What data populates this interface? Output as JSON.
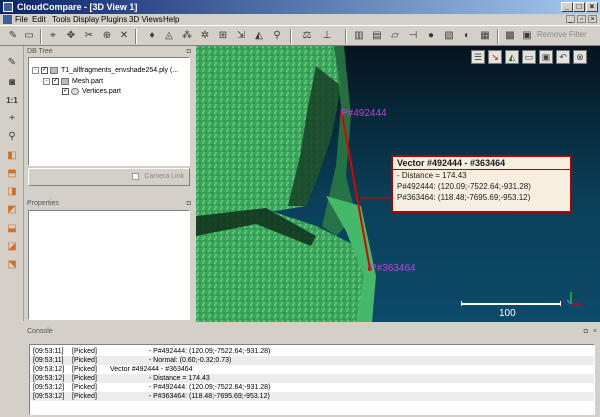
{
  "window": {
    "title": "CloudCompare - [3D View 1]",
    "minimize_label": "_",
    "maximize_label": "□",
    "close_label": "×"
  },
  "menu": {
    "items": [
      "File",
      "Edit",
      "Tools",
      "Display",
      "Plugins",
      "3D Views",
      "Help"
    ],
    "mdi_buttons": [
      "_",
      "▫",
      "×"
    ]
  },
  "toolbar": {
    "remove_filter_label": "Remove Filter",
    "icons": [
      "open-icon",
      "save-icon",
      "select-icon",
      "translate-icon",
      "segment-icon",
      "merge-icon",
      "delete-icon",
      "pick-point-icon",
      "mesh-icon",
      "sample-icon",
      "normals-icon",
      "octree-icon",
      "distance-icon",
      "filter-icon",
      "pivot-icon",
      "histogram-icon",
      "statistics-icon",
      "plane-icon",
      "sphere-icon",
      "scalar-field-icon",
      "color-icon",
      "sf-gradient-icon"
    ]
  },
  "left_toolbar": {
    "icons": [
      "ruler-icon",
      "camera-icon",
      "one-to-one-icon",
      "crosshair-icon",
      "zoom-icon",
      "front-view-icon",
      "top-view-icon",
      "left-view-icon",
      "back-view-icon",
      "bottom-view-icon",
      "right-view-icon",
      "iso-view-icon"
    ]
  },
  "db_tree": {
    "title": "DB Tree",
    "float_button": "◘",
    "items": [
      {
        "label": "T1_allfragments_envshade254.ply (...",
        "level": 0,
        "expand": "-",
        "checked": "✓"
      },
      {
        "label": "Mesh.part",
        "level": 1,
        "expand": "-",
        "checked": "✓"
      },
      {
        "label": "Vertices.part",
        "level": 2,
        "expand": "",
        "checked": "✓"
      }
    ],
    "camera_link_label": "Camera Link"
  },
  "properties": {
    "title": "Properties",
    "float_button": "◘"
  },
  "view3d": {
    "tool_icons": [
      "layers-icon",
      "pick-vector-icon",
      "pick-triangle-icon",
      "pick-rect-icon",
      "save-pick-icon",
      "undo-icon",
      "close-icon"
    ],
    "tooltip": {
      "title": "Vector #492444 - #363464",
      "lines": [
        "- Distance = 174.43",
        "P#492444: (120.09;-7522.64;-931.28)",
        "P#363464: (118.48;-7695.69;-953.12)"
      ]
    },
    "point_a_label": "P#492444",
    "point_b_label": "P#363464",
    "scale_label": "100",
    "colors": {
      "vector": "#e00000",
      "label": "#c040e0",
      "mesh": "#38a858",
      "background_top": "#05141f",
      "background_bottom": "#0c4a6a"
    }
  },
  "console": {
    "title": "Console",
    "buttons": [
      "◘",
      "×"
    ],
    "rows": [
      {
        "time": "[09:53:11]",
        "tag": "[Picked]",
        "msg": "                    - P#492444: (120.09;-7522.64;-931.28)"
      },
      {
        "time": "[09:53:11]",
        "tag": "[Picked]",
        "msg": "                    - Normal: (0.60;-0.32;0.73)"
      },
      {
        "time": "[09:53:12]",
        "tag": "[Picked]",
        "msg": "Vector #492444 - #363464"
      },
      {
        "time": "[09:53:12]",
        "tag": "[Picked]",
        "msg": "                    - Distance = 174.43"
      },
      {
        "time": "[09:53:12]",
        "tag": "[Picked]",
        "msg": "                    - P#492444: (120.09;-7522.64;-931.28)"
      },
      {
        "time": "[09:53:12]",
        "tag": "[Picked]",
        "msg": "                    - P#363464: (118.48;-7695.69;-953.12)"
      }
    ]
  }
}
